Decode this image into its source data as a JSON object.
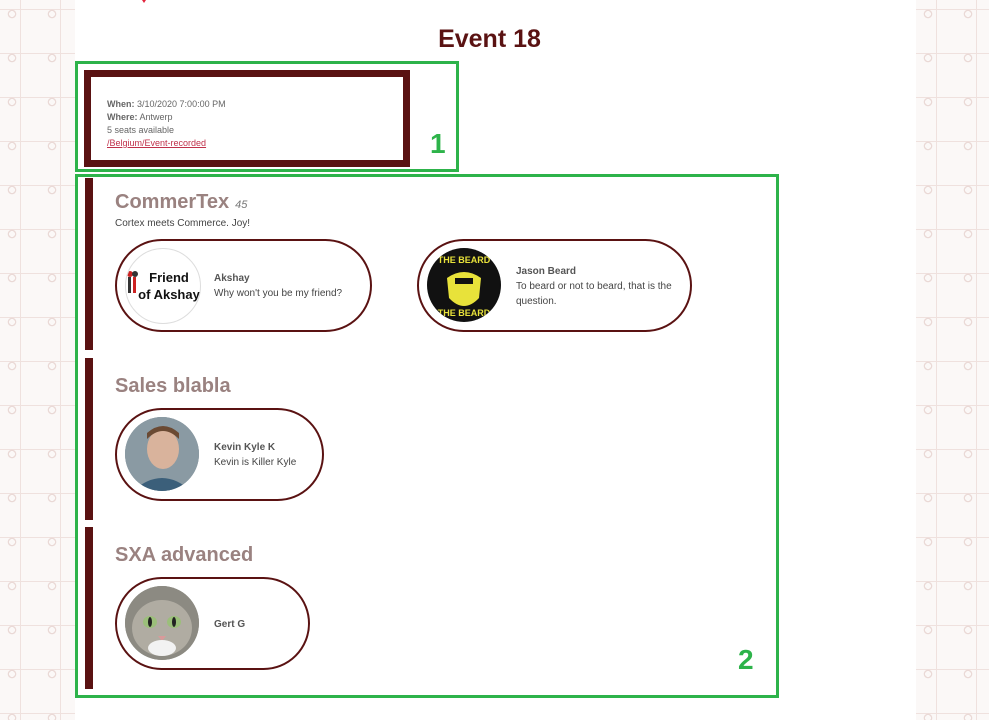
{
  "page": {
    "title": "Event 18"
  },
  "event": {
    "when_label": "When:",
    "when": "3/10/2020 7:00:00 PM",
    "where_label": "Where:",
    "where": "Antwerp",
    "seats": "5 seats available",
    "link": "/Belgium/Event-recorded"
  },
  "annotations": {
    "box1": "1",
    "box2": "2"
  },
  "sessions": [
    {
      "title": "CommerTex",
      "number": "45",
      "description": "Cortex meets Commerce. Joy!",
      "speakers": [
        {
          "name": "Akshay",
          "bio": "Why won't you be my friend?",
          "avatar_text_1": "Friend",
          "avatar_text_2": "of Akshay"
        },
        {
          "name": "Jason Beard",
          "bio": "To beard or not to beard, that is the question.",
          "avatar_text_1": "THE BEARD",
          "avatar_text_2": "THE BEARD"
        }
      ]
    },
    {
      "title": "Sales blabla",
      "speakers": [
        {
          "name": "Kevin Kyle K",
          "bio": "Kevin is Killer Kyle"
        }
      ]
    },
    {
      "title": "SXA advanced",
      "speakers": [
        {
          "name": "Gert G"
        }
      ]
    }
  ],
  "colors": {
    "accent": "#5a1212",
    "annotation": "#2db34a",
    "link": "#c0304a"
  }
}
